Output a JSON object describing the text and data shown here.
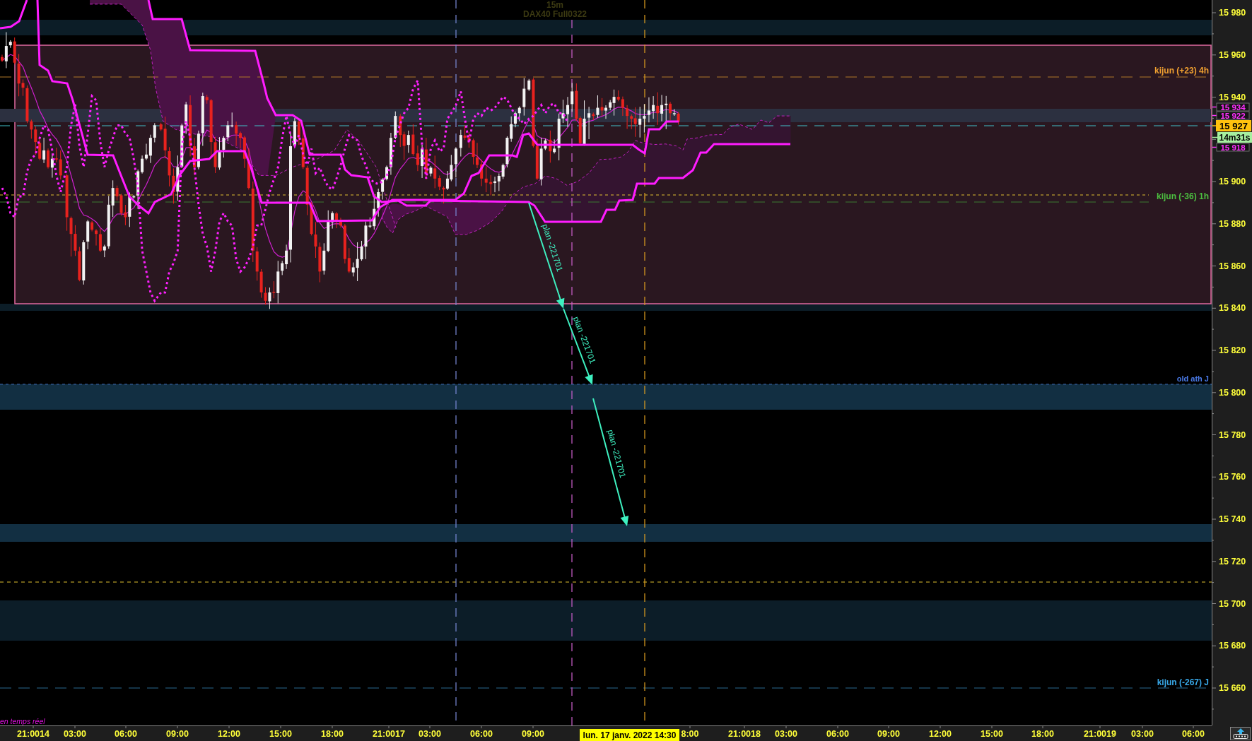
{
  "chart": {
    "timeframe": "15m",
    "instrument": "DAX40 Full0322",
    "status": "en temps réel",
    "level_labels": [
      {
        "text": "kijun (+23) 4h",
        "color": "#f0a030"
      },
      {
        "text": "kijun (-36) 1h",
        "color": "#4cc040"
      },
      {
        "text": "old ath J",
        "color": "#4a7ae8"
      },
      {
        "text": "kijun (-267) J",
        "color": "#38a8e8"
      }
    ],
    "drawings": [
      {
        "label": "plan -221701"
      },
      {
        "label": "plan -221701"
      },
      {
        "label": "plan -221701"
      }
    ]
  },
  "price_axis": {
    "labels": [
      "15 980",
      "15 960",
      "15 940",
      "15 900",
      "15 880",
      "15 860",
      "15 840",
      "15 820",
      "15 800",
      "15 780",
      "15 760",
      "15 740",
      "15 720",
      "15 700",
      "15 680",
      "15 660"
    ],
    "tags": [
      {
        "text": "15 934",
        "kind": "level"
      },
      {
        "text": "15 922",
        "kind": "level"
      },
      {
        "text": "15 927",
        "kind": "last"
      },
      {
        "text": "14m31s",
        "kind": "countdown"
      },
      {
        "text": "15 918",
        "kind": "level"
      }
    ]
  },
  "time_axis": {
    "labels": [
      "21:0014",
      "03:00",
      "06:00",
      "09:00",
      "12:00",
      "15:00",
      "18:00",
      "21:0017",
      "03:00",
      "06:00",
      "09:00",
      "8:00",
      "21:0018",
      "03:00",
      "06:00",
      "09:00",
      "12:00",
      "15:00",
      "18:00",
      "21:0019",
      "03:00",
      "06:00"
    ],
    "cursor": "lun. 17 janv. 2022 14:30"
  }
}
